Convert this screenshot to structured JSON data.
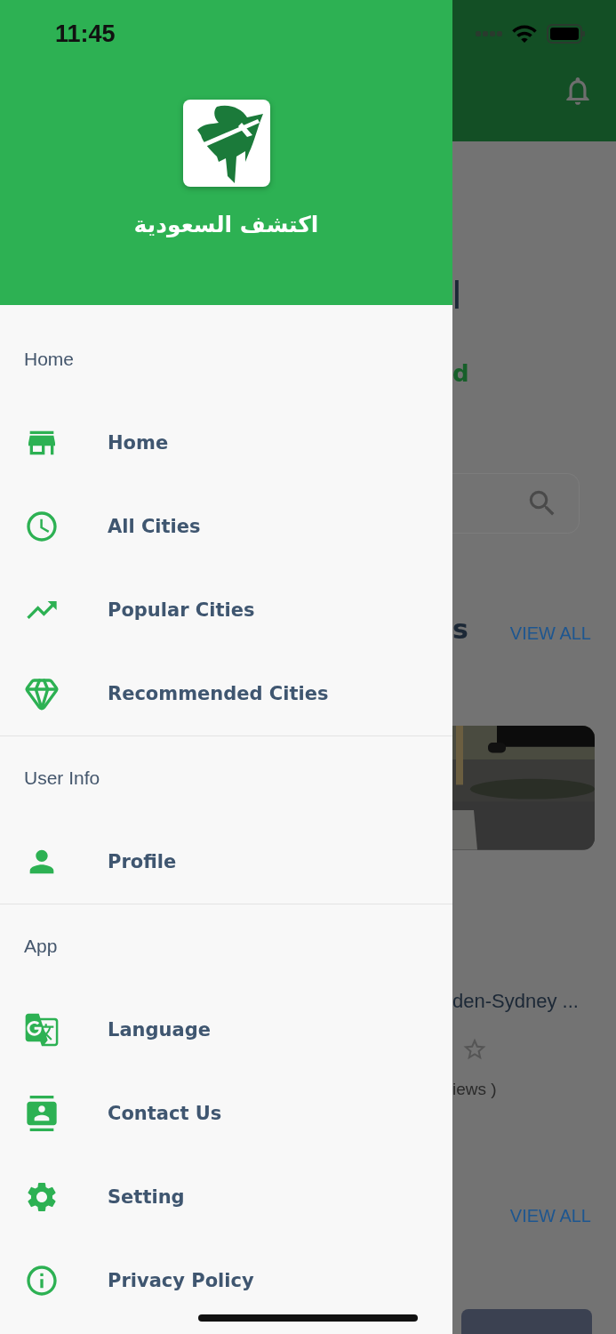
{
  "status_bar": {
    "time": "11:45"
  },
  "drawer": {
    "app_title": "اكتشف السعودية",
    "sections": [
      {
        "heading": "Home",
        "items": [
          {
            "label": "Home",
            "kind": "home"
          },
          {
            "label": "All Cities",
            "kind": "cities"
          },
          {
            "label": "Popular Cities",
            "kind": "popular"
          },
          {
            "label": "Recommended Cities",
            "kind": "recommended"
          }
        ]
      },
      {
        "heading": "User Info",
        "items": [
          {
            "label": "Profile",
            "kind": "profile"
          }
        ]
      },
      {
        "heading": "App",
        "items": [
          {
            "label": "Language",
            "kind": "language"
          },
          {
            "label": "Contact Us",
            "kind": "contact"
          },
          {
            "label": "Setting",
            "kind": "setting"
          },
          {
            "label": "Privacy Policy",
            "kind": "privacy"
          }
        ]
      }
    ]
  },
  "background_screen": {
    "heading_fragment": "l",
    "subtitle_fragment": "d",
    "section_title_fragment": "s",
    "view_all_links": [
      "VIEW ALL",
      "VIEW ALL"
    ],
    "place_name": "den-Sydney ...",
    "reviews_fragment": "iews )"
  }
}
